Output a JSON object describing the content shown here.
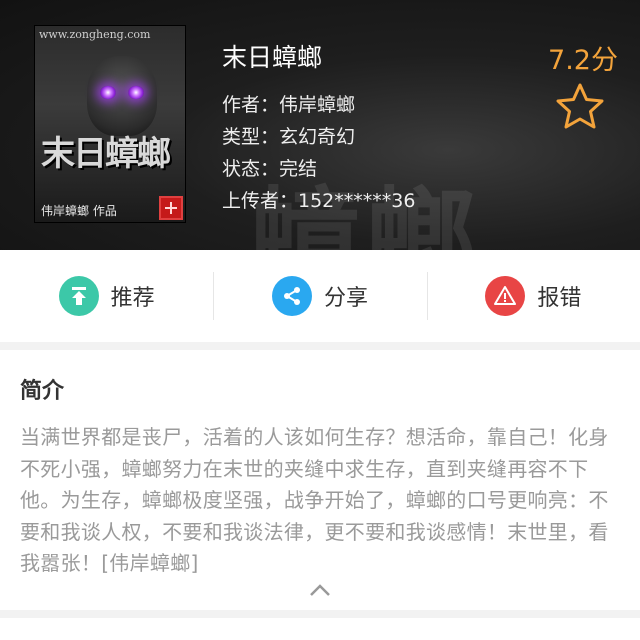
{
  "book": {
    "cover_site": "www.zongheng.com",
    "cover_title": "末日蟑螂",
    "cover_author": "伟岸蟑螂 作品",
    "watermark": "蟑螂",
    "title": "末日蟑螂",
    "rating": "7.2分",
    "author_line": "作者：伟岸蟑螂",
    "category_line": "类型：玄幻奇幻",
    "status_line": "状态：完结",
    "uploader_line": "上传者：152******36"
  },
  "actions": [
    {
      "label": "推荐",
      "icon": "recommend-up-icon",
      "color": "#3cc8a8"
    },
    {
      "label": "分享",
      "icon": "share-icon",
      "color": "#2aa8f0"
    },
    {
      "label": "报错",
      "icon": "warning-icon",
      "color": "#e84545"
    }
  ],
  "intro": {
    "heading": "简介",
    "text": "当满世界都是丧尸，活着的人该如何生存？想活命，靠自己！化身不死小强，蟑螂努力在末世的夹缝中求生存，直到夹缝再容不下他。为生存，蟑螂极度坚强，战争开始了，蟑螂的口号更响亮：不要和我谈人权，不要和我谈法律，更不要和我谈感情！末世里，看我嚣张！[伟岸蟑螂]"
  },
  "colors": {
    "rating": "#f3a33b",
    "header_bg": "#1a1a1a",
    "intro_text": "#9a9a9a"
  }
}
